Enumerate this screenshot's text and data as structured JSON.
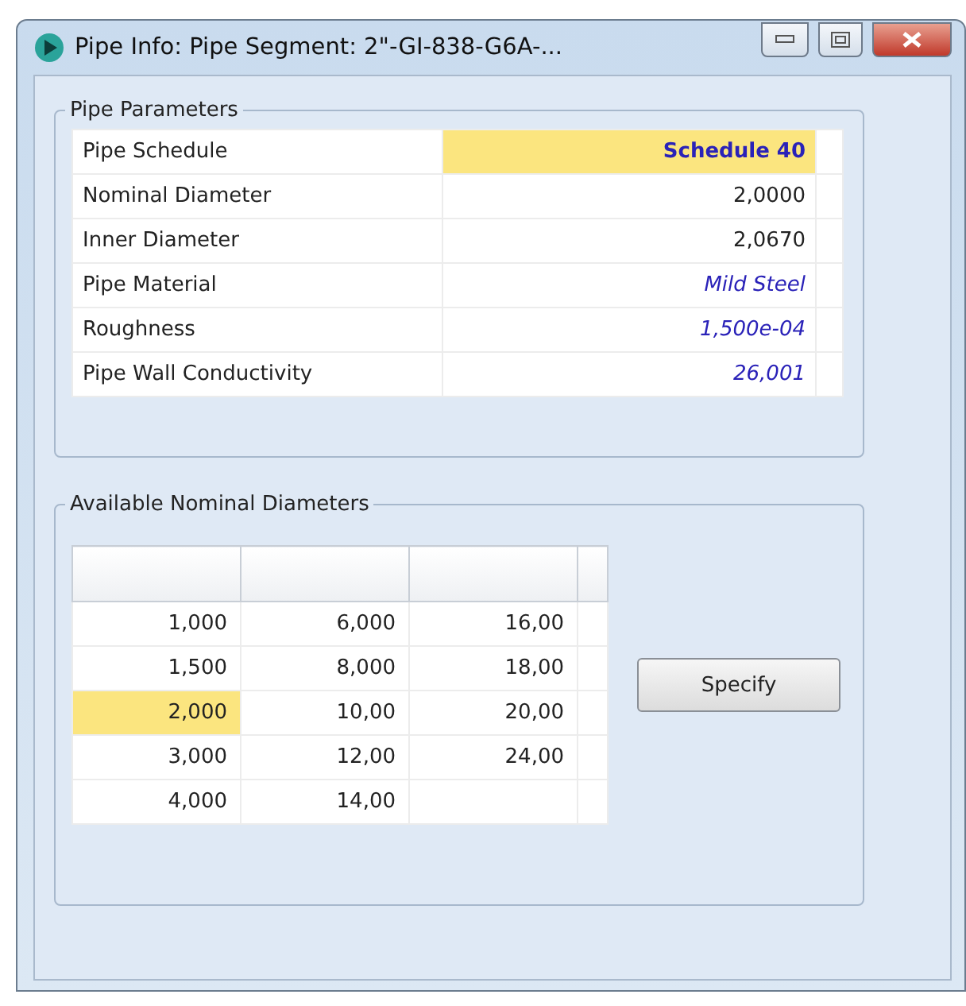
{
  "window": {
    "title": "Pipe Info: Pipe Segment: 2\"-GI-838-G6A-..."
  },
  "pipe_parameters": {
    "title": "Pipe Parameters",
    "rows": [
      {
        "label": "Pipe Schedule",
        "value": "Schedule 40",
        "kind": "bold",
        "selected": true
      },
      {
        "label": "Nominal Diameter",
        "value": "2,0000",
        "kind": "plain",
        "selected": false
      },
      {
        "label": "Inner Diameter",
        "value": "2,0670",
        "kind": "plain",
        "selected": false
      },
      {
        "label": "Pipe Material",
        "value": "Mild Steel",
        "kind": "italic",
        "selected": false
      },
      {
        "label": "Roughness",
        "value": "1,500e-04",
        "kind": "italic",
        "selected": false
      },
      {
        "label": "Pipe Wall Conductivity",
        "value": "26,001",
        "kind": "italic",
        "selected": false
      }
    ]
  },
  "available_diameters": {
    "title": "Available Nominal Diameters",
    "rows": [
      [
        {
          "value": "1,000",
          "selected": false
        },
        {
          "value": "6,000",
          "selected": false
        },
        {
          "value": "16,00",
          "selected": false
        }
      ],
      [
        {
          "value": "1,500",
          "selected": false
        },
        {
          "value": "8,000",
          "selected": false
        },
        {
          "value": "18,00",
          "selected": false
        }
      ],
      [
        {
          "value": "2,000",
          "selected": true
        },
        {
          "value": "10,00",
          "selected": false
        },
        {
          "value": "20,00",
          "selected": false
        }
      ],
      [
        {
          "value": "3,000",
          "selected": false
        },
        {
          "value": "12,00",
          "selected": false
        },
        {
          "value": "24,00",
          "selected": false
        }
      ],
      [
        {
          "value": "4,000",
          "selected": false
        },
        {
          "value": "14,00",
          "selected": false
        }
      ]
    ],
    "button": "Specify"
  }
}
